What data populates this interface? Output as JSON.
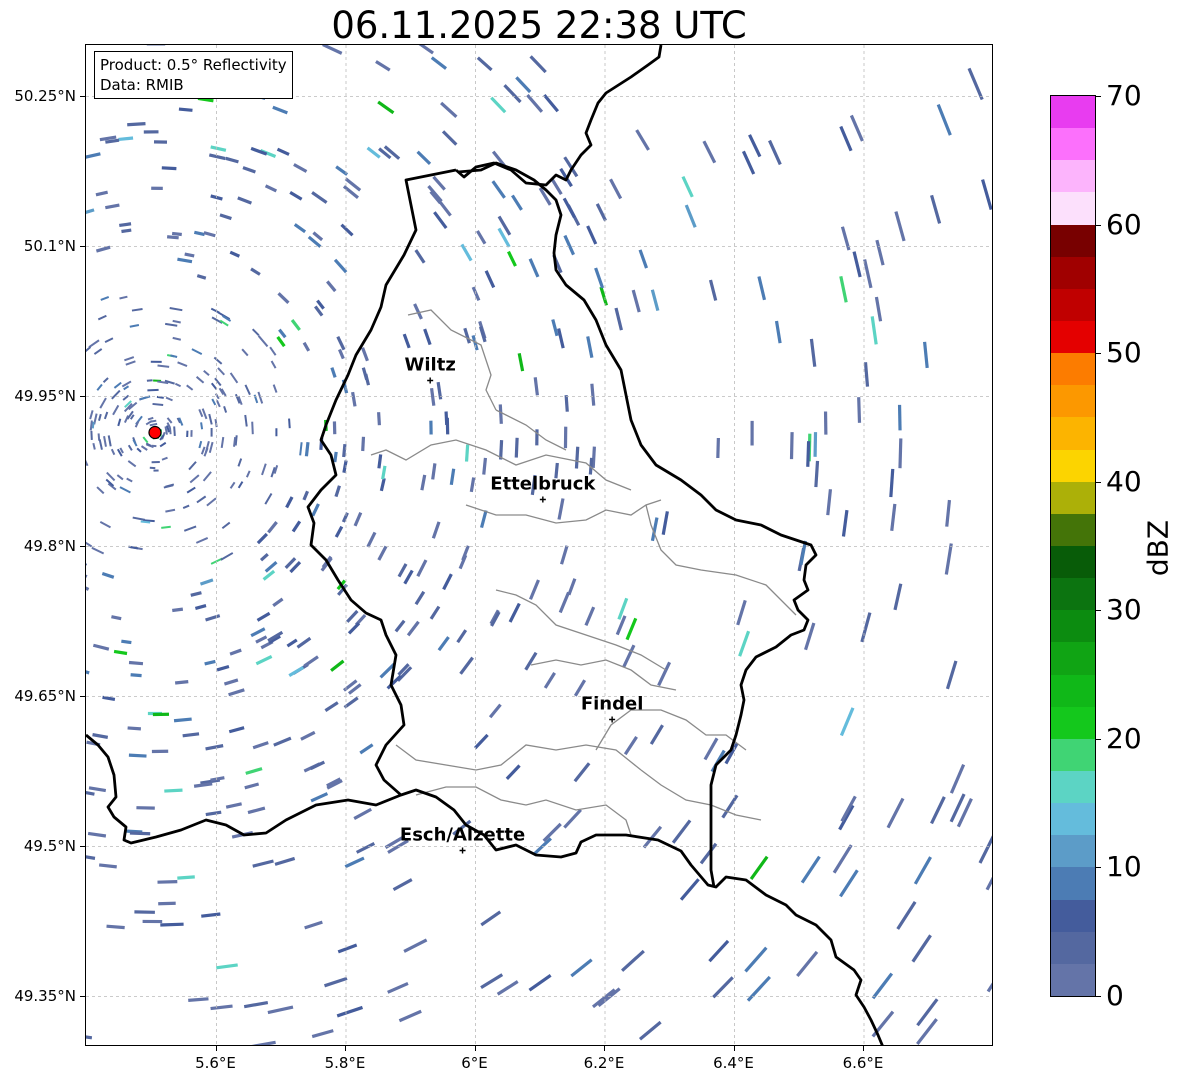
{
  "title": "06.11.2025 22:38 UTC",
  "info": {
    "product": "Product: 0.5° Reflectivity",
    "data": "Data: RMIB"
  },
  "map": {
    "lat_ticks": [
      "50.25°N",
      "50.1°N",
      "49.95°N",
      "49.8°N",
      "49.65°N",
      "49.5°N",
      "49.35°N"
    ],
    "lon_ticks": [
      "5.6°E",
      "5.8°E",
      "6°E",
      "6.2°E",
      "6.4°E",
      "6.6°E"
    ],
    "cities": [
      {
        "name": "Wiltz",
        "lon": 5.93,
        "lat": 49.966
      },
      {
        "name": "Ettelbruck",
        "lon": 6.104,
        "lat": 49.847
      },
      {
        "name": "Findel",
        "lon": 6.211,
        "lat": 49.627
      },
      {
        "name": "Esch/Alzette",
        "lon": 5.98,
        "lat": 49.496
      }
    ],
    "radar_site": {
      "lon": 5.505,
      "lat": 49.914
    }
  },
  "colorbar": {
    "label": "dBZ",
    "ticks": [
      "0",
      "10",
      "20",
      "30",
      "40",
      "50",
      "60",
      "70"
    ],
    "colors": [
      "#6474a8",
      "#5468a0",
      "#445c9c",
      "#4c7cb4",
      "#5c9cc8",
      "#64bcdc",
      "#5cd4c4",
      "#40d474",
      "#14c81c",
      "#10b818",
      "#10a414",
      "#0c8c10",
      "#0c7410",
      "#085c08",
      "#447408",
      "#acb008",
      "#fcd400",
      "#fcb400",
      "#fc9800",
      "#fc7c00",
      "#e40000",
      "#c00000",
      "#a00000",
      "#780000",
      "#fce0fc",
      "#fcb4fc",
      "#fc70fc",
      "#e83cf0"
    ]
  }
}
